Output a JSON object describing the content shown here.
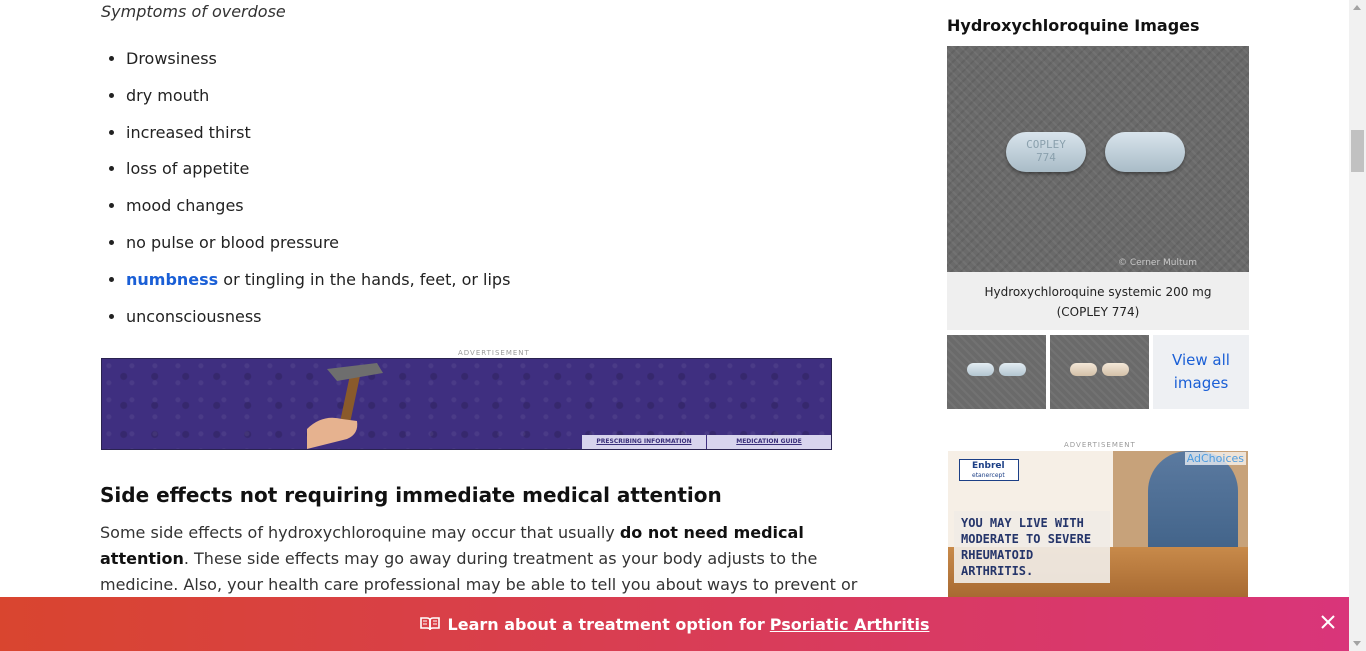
{
  "overdose": {
    "title": "Symptoms of overdose",
    "items": [
      {
        "text": "Drowsiness"
      },
      {
        "text": "dry mouth"
      },
      {
        "text": "increased thirst"
      },
      {
        "text": "loss of appetite"
      },
      {
        "text": "mood changes"
      },
      {
        "text": "no pulse or blood pressure"
      },
      {
        "link": "numbness",
        "text": " or tingling in the hands, feet, or lips"
      },
      {
        "text": "unconsciousness"
      }
    ]
  },
  "ad_label": "ADVERTISEMENT",
  "banner_ad": {
    "prescribing": "PRESCRIBING INFORMATION",
    "medication_guide": "MEDICATION GUIDE"
  },
  "side_effects": {
    "heading": "Side effects not requiring immediate medical attention",
    "text_before": "Some side effects of hydroxychloroquine may occur that usually ",
    "text_bold": "do not need medical attention",
    "text_after": ". These side effects may go away during treatment as your body adjusts to the medicine. Also, your health care professional may be able to tell you about ways to prevent or reduce some of these side effects."
  },
  "sidebar": {
    "title": "Hydroxychloroquine Images",
    "pill_imprint_line1": "COPLEY",
    "pill_imprint_line2": "774",
    "watermark": "© Cerner Multum",
    "caption": "Hydroxychloroquine systemic 200 mg (COPLEY 774)",
    "view_all": "View all images"
  },
  "side_ad": {
    "brand": "Enbrel",
    "brand_sub": "etanercept",
    "adchoices": "AdChoices",
    "message": "YOU MAY LIVE WITH MODERATE TO SEVERE RHEUMATOID ARTHRITIS."
  },
  "sticky": {
    "prefix": "Learn about a treatment option for",
    "link": "Psoriatic Arthritis"
  },
  "colors": {
    "link": "#1a5fd6",
    "sticky_start": "#d9452f",
    "sticky_end": "#d9357a",
    "banner_bg": "#3f2f80"
  }
}
